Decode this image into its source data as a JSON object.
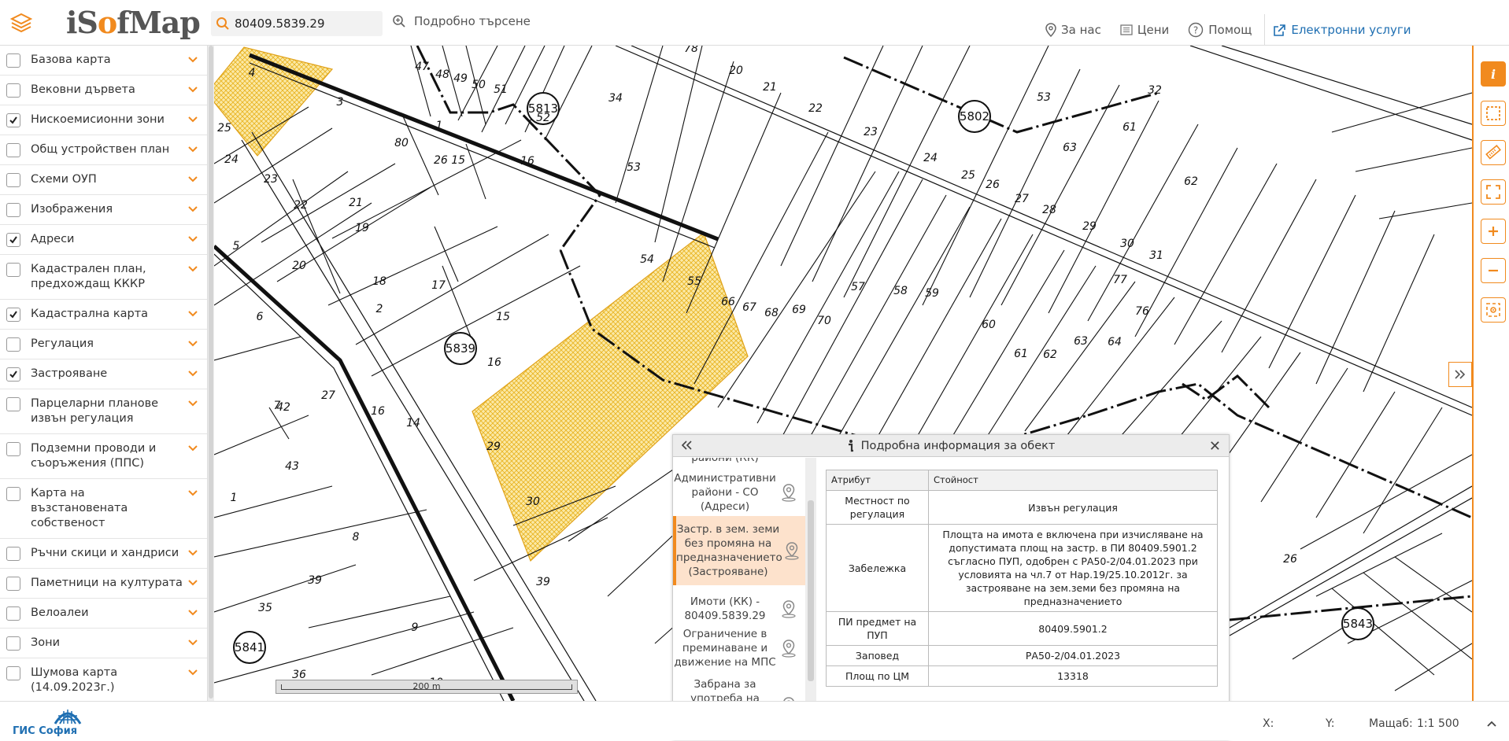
{
  "header": {
    "logo": {
      "part1": "iS",
      "part2": "o",
      "part3": "fMap"
    },
    "search": {
      "value": "80409.5839.29",
      "placeholder": ""
    },
    "advanced_search_label": "Подробно търсене",
    "nav": [
      {
        "label": "За нас",
        "icon": "location-pin-icon"
      },
      {
        "label": "Цени",
        "icon": "price-list-icon"
      },
      {
        "label": "Помощ",
        "icon": "help-icon"
      }
    ],
    "eservices_label": "Електронни услуги",
    "colors": {
      "accent": "#f18a1e",
      "link": "#1f6fb2"
    }
  },
  "sidebar": {
    "layers": [
      {
        "label": "Базова карта",
        "checked": false
      },
      {
        "label": "Вековни дървета",
        "checked": false
      },
      {
        "label": "Нискоемисионни зони",
        "checked": true
      },
      {
        "label": "Общ устройствен план",
        "checked": false
      },
      {
        "label": "Схеми ОУП",
        "checked": false
      },
      {
        "label": "Изображения",
        "checked": false
      },
      {
        "label": "Адреси",
        "checked": true
      },
      {
        "label": "Кадастрален план, предхождащ КККР",
        "checked": false
      },
      {
        "label": "Кадастрална карта",
        "checked": true
      },
      {
        "label": "Регулация",
        "checked": false
      },
      {
        "label": "Застрояване",
        "checked": true
      },
      {
        "label": "Парцеларни планове извън регулация",
        "checked": false
      },
      {
        "label": "Подземни проводи и съоръжения (ППС)",
        "checked": false
      },
      {
        "label": "Карта на възстановената собственост",
        "checked": false
      },
      {
        "label": "Ръчни скици и хандриси",
        "checked": false
      },
      {
        "label": "Паметници на културата",
        "checked": false
      },
      {
        "label": "Велоалеи",
        "checked": false
      },
      {
        "label": "Зони",
        "checked": false
      },
      {
        "label": "Шумова карта (14.09.2023г.)",
        "checked": false
      }
    ]
  },
  "map": {
    "parcel_labels": [
      "4",
      "3",
      "25",
      "24",
      "23",
      "22",
      "21",
      "19",
      "20",
      "18",
      "17",
      "15",
      "16",
      "14",
      "29",
      "5",
      "6",
      "7",
      "27",
      "42",
      "43",
      "1",
      "2",
      "8",
      "39",
      "35",
      "36",
      "9",
      "10",
      "30",
      "39",
      "34",
      "47",
      "48",
      "49",
      "50",
      "51",
      "52",
      "34",
      "53",
      "54",
      "55",
      "66",
      "67",
      "68",
      "69",
      "70",
      "57",
      "58",
      "59",
      "60",
      "61",
      "62",
      "63",
      "64",
      "76",
      "77",
      "78",
      "20",
      "21",
      "22",
      "23",
      "24",
      "25",
      "26",
      "27",
      "28",
      "29",
      "30",
      "31",
      "32",
      "53",
      "61",
      "62",
      "63",
      "80",
      "26 15",
      "16",
      "1",
      "2",
      "16",
      "29",
      "30",
      "26",
      "27",
      "66"
    ],
    "sheet_labels": [
      "5813",
      "5839",
      "5802",
      "5841",
      "5843"
    ],
    "scale_label": "200 m",
    "highlight_color": "#f5c842"
  },
  "info_panel": {
    "title": "Подробна информация за обект",
    "objects": [
      {
        "label": "райони (КК)"
      },
      {
        "label": "Административни райони - СО (Адреси)"
      },
      {
        "label": "Застр. в зем. земи без промяна на предназначението (Застрояване)",
        "selected": true
      },
      {
        "label": "Имоти (КК) - 80409.5839.29"
      },
      {
        "label": "Ограничение в преминаване и движение на МПС"
      },
      {
        "label": "Забрана за употреба на твърди горива за битово отопление"
      }
    ],
    "table": {
      "headers": [
        "Атрибут",
        "Стойност"
      ],
      "rows": [
        {
          "key": "Местност по регулация",
          "value": "Извън регулация"
        },
        {
          "key": "Забележка",
          "value": "Площта на имота е включена при изчисляване на допустимата площ на застр. в ПИ 80409.5901.2 съгласно ПУП, одобрен с РА50-2/04.01.2023 при условията на чл.7 от Нар.19/25.10.2012г. за застрояване на зем.земи без промяна на предназначението"
        },
        {
          "key": "ПИ предмет на ПУП",
          "value": "80409.5901.2"
        },
        {
          "key": "Заповед",
          "value": "РА50-2/04.01.2023"
        },
        {
          "key": "Площ по ЦМ",
          "value": "13318"
        }
      ]
    }
  },
  "footer": {
    "logo_text": "ГИС София",
    "x_label": "X:",
    "y_label": "Y:",
    "scale_label": "Мащаб:",
    "scale_value": "1:1 500"
  }
}
